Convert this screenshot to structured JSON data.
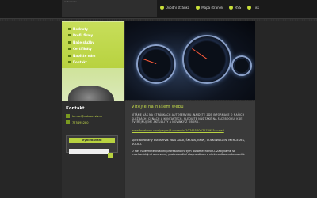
{
  "brand": {
    "text": "Autoservis"
  },
  "top_nav": [
    {
      "label": "Úvodní stránka"
    },
    {
      "label": "Mapa stránek"
    },
    {
      "label": "RSS"
    },
    {
      "label": "Tisk"
    }
  ],
  "sidebar": {
    "items": [
      {
        "label": "Hodnoty"
      },
      {
        "label": "Profil firmy"
      },
      {
        "label": "Naše služby"
      },
      {
        "label": "Certifikáty"
      },
      {
        "label": "Napište nám"
      },
      {
        "label": "Kontakt"
      }
    ]
  },
  "contact": {
    "title": "Kontakt",
    "email": "lomuc@autoservis.cz",
    "phone": "775495280"
  },
  "search": {
    "label": "Vyhledávání"
  },
  "content": {
    "title": "Vítejte na našem webu",
    "para1": "Vítáme vás na stránkách autoservisu. Najdete zde informace o našich službách, cenách a kontaktech. Sledujte nás také na Facebooku, kde zveřejňujeme aktuality a novinky z oboru.",
    "link": "www.facebook.com/pages/Autoservis/107455606727895?v=wall",
    "body1": "Specializovaný autoservis vozů AUDI, ŠKODA, BMW, VOLKSWAGEN, MERCEDES, VOLVO.",
    "body2": "U nás naleznete kvalitní profesionální tým automechaniků. Zabýváme se mechanickými opravami, profesionální diagnostikou a elektronikou automobilů."
  },
  "colors": {
    "accent": "#b8d240",
    "background": "#2b2b2b",
    "sidebar": "#d8e8a0"
  }
}
